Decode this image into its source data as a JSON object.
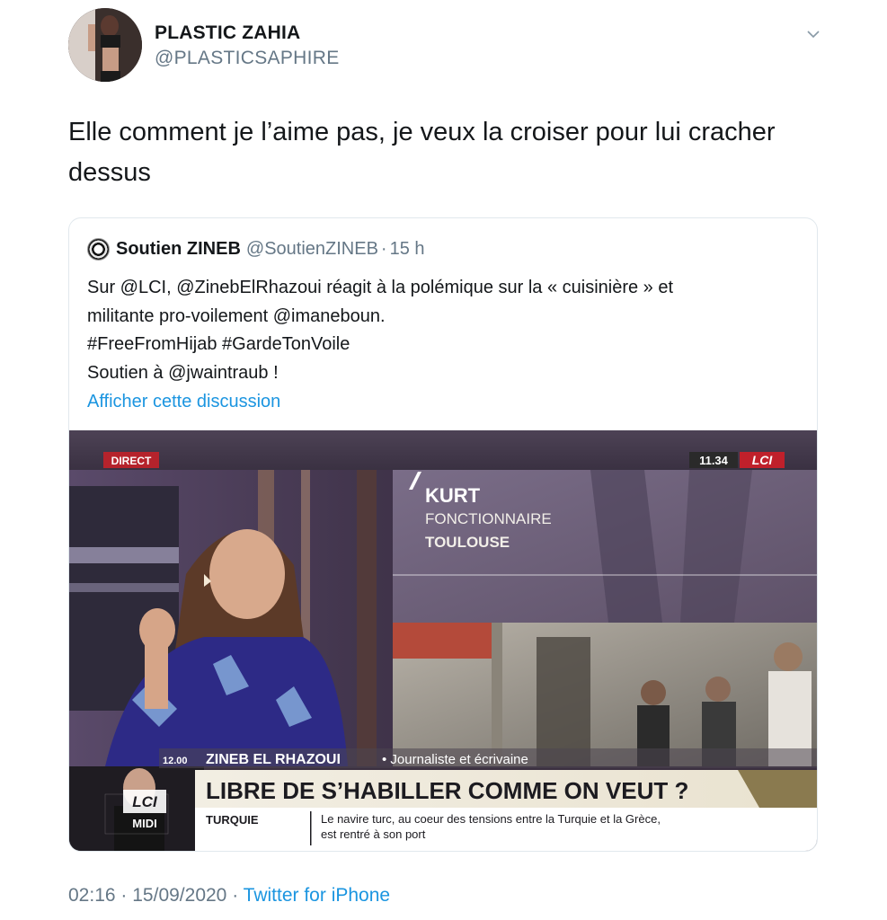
{
  "author": {
    "name": "PLASTIC ZAHIA",
    "handle": "@PLASTICSAPHIRE"
  },
  "tweet": {
    "lines": [
      "Elle comment je l’aime pas, je veux la croiser pour lui cracher",
      "dessus"
    ]
  },
  "quoted": {
    "name": "Soutien ZINEB",
    "handle": "@SoutienZINEB",
    "separator": "·",
    "time": "15 h",
    "lines": [
      "Sur @LCI, @ZinebElRhazoui réagit à la polémique sur la « cuisinière » et",
      "militante pro-voilement @imaneboun.",
      "#FreeFromHijab #GardeTonVoile",
      "Soutien à @jwaintraub !"
    ],
    "show_thread": "Afficher cette discussion"
  },
  "video": {
    "live_badge": "DIRECT",
    "clock": "11.34",
    "channel": "LCI",
    "guest_name": "KURT",
    "guest_role": "FONCTIONNAIRE",
    "guest_city": "TOULOUSE",
    "show_time": "12.00",
    "speaker_name": "ZINEB EL RHAZOUI",
    "speaker_title": "• Journaliste et écrivaine",
    "headline": "LIBRE DE S’HABILLER COMME ON VEUT ?",
    "ticker_tag": "TURQUIE",
    "ticker_lines": [
      "Le navire turc, au coeur des tensions entre la Turquie et la Grèce,",
      "est rentré à son port"
    ],
    "show_logo_top": "LCI",
    "show_logo_bottom": "MIDI"
  },
  "meta": {
    "time": "02:16",
    "sep1": "·",
    "date": "15/09/2020",
    "sep2": "·",
    "source": "Twitter for iPhone"
  },
  "colors": {
    "link": "#1b95e0",
    "secondary_text": "#657786",
    "border": "#e1e8ed",
    "live_red": "#b5232c"
  }
}
